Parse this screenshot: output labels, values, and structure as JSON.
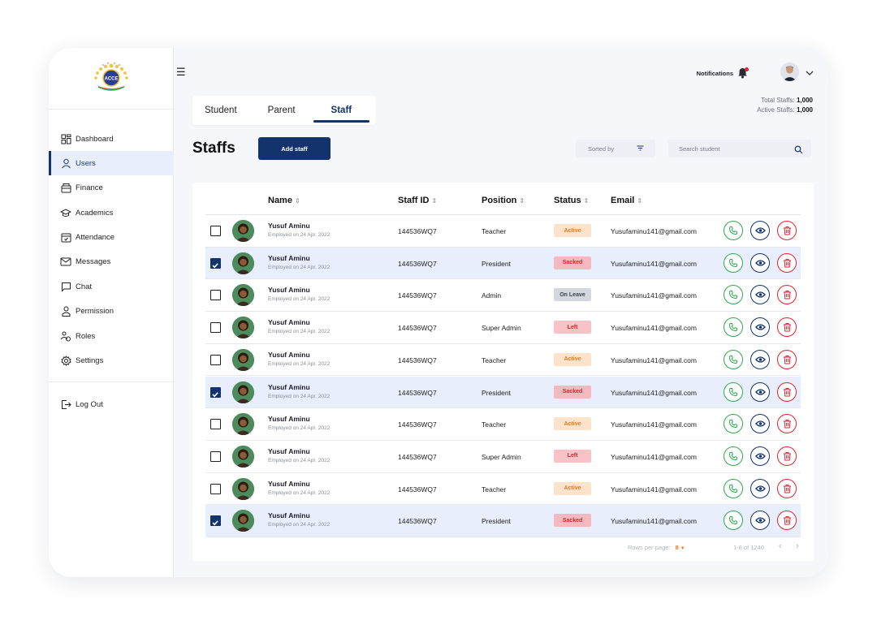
{
  "logo": {
    "text": "ACCE"
  },
  "sidebar": {
    "items": [
      {
        "label": "Dashboard",
        "icon": "dashboard-icon"
      },
      {
        "label": "Users",
        "icon": "user-icon",
        "active": true
      },
      {
        "label": "Finance",
        "icon": "finance-icon"
      },
      {
        "label": "Academics",
        "icon": "graduation-cap-icon"
      },
      {
        "label": "Attendance",
        "icon": "calendar-icon"
      },
      {
        "label": "Messages",
        "icon": "mail-icon"
      },
      {
        "label": "Chat",
        "icon": "chat-icon"
      },
      {
        "label": "Permission",
        "icon": "person-icon"
      },
      {
        "label": "Roles",
        "icon": "roles-icon"
      },
      {
        "label": "Settings",
        "icon": "gear-icon"
      }
    ],
    "logout": "Log Out"
  },
  "header": {
    "notifications_label": "Notifications",
    "totals": {
      "total_label": "Total Staffs:",
      "total_value": "1,000",
      "active_label": "Active Staffs:",
      "active_value": "1,000"
    }
  },
  "tabs": [
    "Student",
    "Parent",
    "Staff"
  ],
  "active_tab": "Staff",
  "page_title": "Staffs",
  "add_button": "Add staff",
  "sort_label": "Sorted by",
  "search_placeholder": "Search student",
  "table": {
    "columns": [
      "Name",
      "Staff ID",
      "Position",
      "Status",
      "Email"
    ],
    "rows": [
      {
        "name": "Yusuf Aminu",
        "employed": "Employed on 24 Apr. 2022",
        "id": "144536WQ7",
        "position": "Teacher",
        "status": "Active",
        "email": "Yusufaminu141@gmail.com",
        "checked": false
      },
      {
        "name": "Yusuf Aminu",
        "employed": "Employed on 24 Apr. 2022",
        "id": "144536WQ7",
        "position": "President",
        "status": "Sacked",
        "email": "Yusufaminu141@gmail.com",
        "checked": true
      },
      {
        "name": "Yusuf Aminu",
        "employed": "Employed on 24 Apr. 2022",
        "id": "144536WQ7",
        "position": "Admin",
        "status": "On Leave",
        "email": "Yusufaminu141@gmail.com",
        "checked": false
      },
      {
        "name": "Yusuf Aminu",
        "employed": "Employed on 24 Apr. 2022",
        "id": "144536WQ7",
        "position": "Super Admin",
        "status": "Left",
        "email": "Yusufaminu141@gmail.com",
        "checked": false
      },
      {
        "name": "Yusuf Aminu",
        "employed": "Employed on 24 Apr. 2022",
        "id": "144536WQ7",
        "position": "Teacher",
        "status": "Active",
        "email": "Yusufaminu141@gmail.com",
        "checked": false
      },
      {
        "name": "Yusuf Aminu",
        "employed": "Employed on 24 Apr. 2022",
        "id": "144536WQ7",
        "position": "President",
        "status": "Sacked",
        "email": "Yusufaminu141@gmail.com",
        "checked": true
      },
      {
        "name": "Yusuf Aminu",
        "employed": "Employed on 24 Apr. 2022",
        "id": "144536WQ7",
        "position": "Teacher",
        "status": "Active",
        "email": "Yusufaminu141@gmail.com",
        "checked": false
      },
      {
        "name": "Yusuf Aminu",
        "employed": "Employed on 24 Apr. 2022",
        "id": "144536WQ7",
        "position": "Super Admin",
        "status": "Left",
        "email": "Yusufaminu141@gmail.com",
        "checked": false
      },
      {
        "name": "Yusuf Aminu",
        "employed": "Employed on 24 Apr. 2022",
        "id": "144536WQ7",
        "position": "Teacher",
        "status": "Active",
        "email": "Yusufaminu141@gmail.com",
        "checked": false
      },
      {
        "name": "Yusuf Aminu",
        "employed": "Employed on 24 Apr. 2022",
        "id": "144536WQ7",
        "position": "President",
        "status": "Sacked",
        "email": "Yusufaminu141@gmail.com",
        "checked": true
      }
    ]
  },
  "status_colors": {
    "Active": {
      "bg": "#fde3c9",
      "fg": "#f07a1a"
    },
    "Sacked": {
      "bg": "#f4b9bf",
      "fg": "#d9252f"
    },
    "On Leave": {
      "bg": "#d4d7de",
      "fg": "#3a3f4b"
    },
    "Left": {
      "bg": "#f8c2c6",
      "fg": "#e2222c"
    }
  },
  "footer": {
    "rows_per_page_label": "Rows per page:",
    "rows_per_page_value": "8",
    "range": "1-8 of 1240"
  },
  "colors": {
    "primary": "#12336b",
    "call": "#2fa84f",
    "delete": "#e2222c",
    "selected_row": "#e8eefb"
  }
}
